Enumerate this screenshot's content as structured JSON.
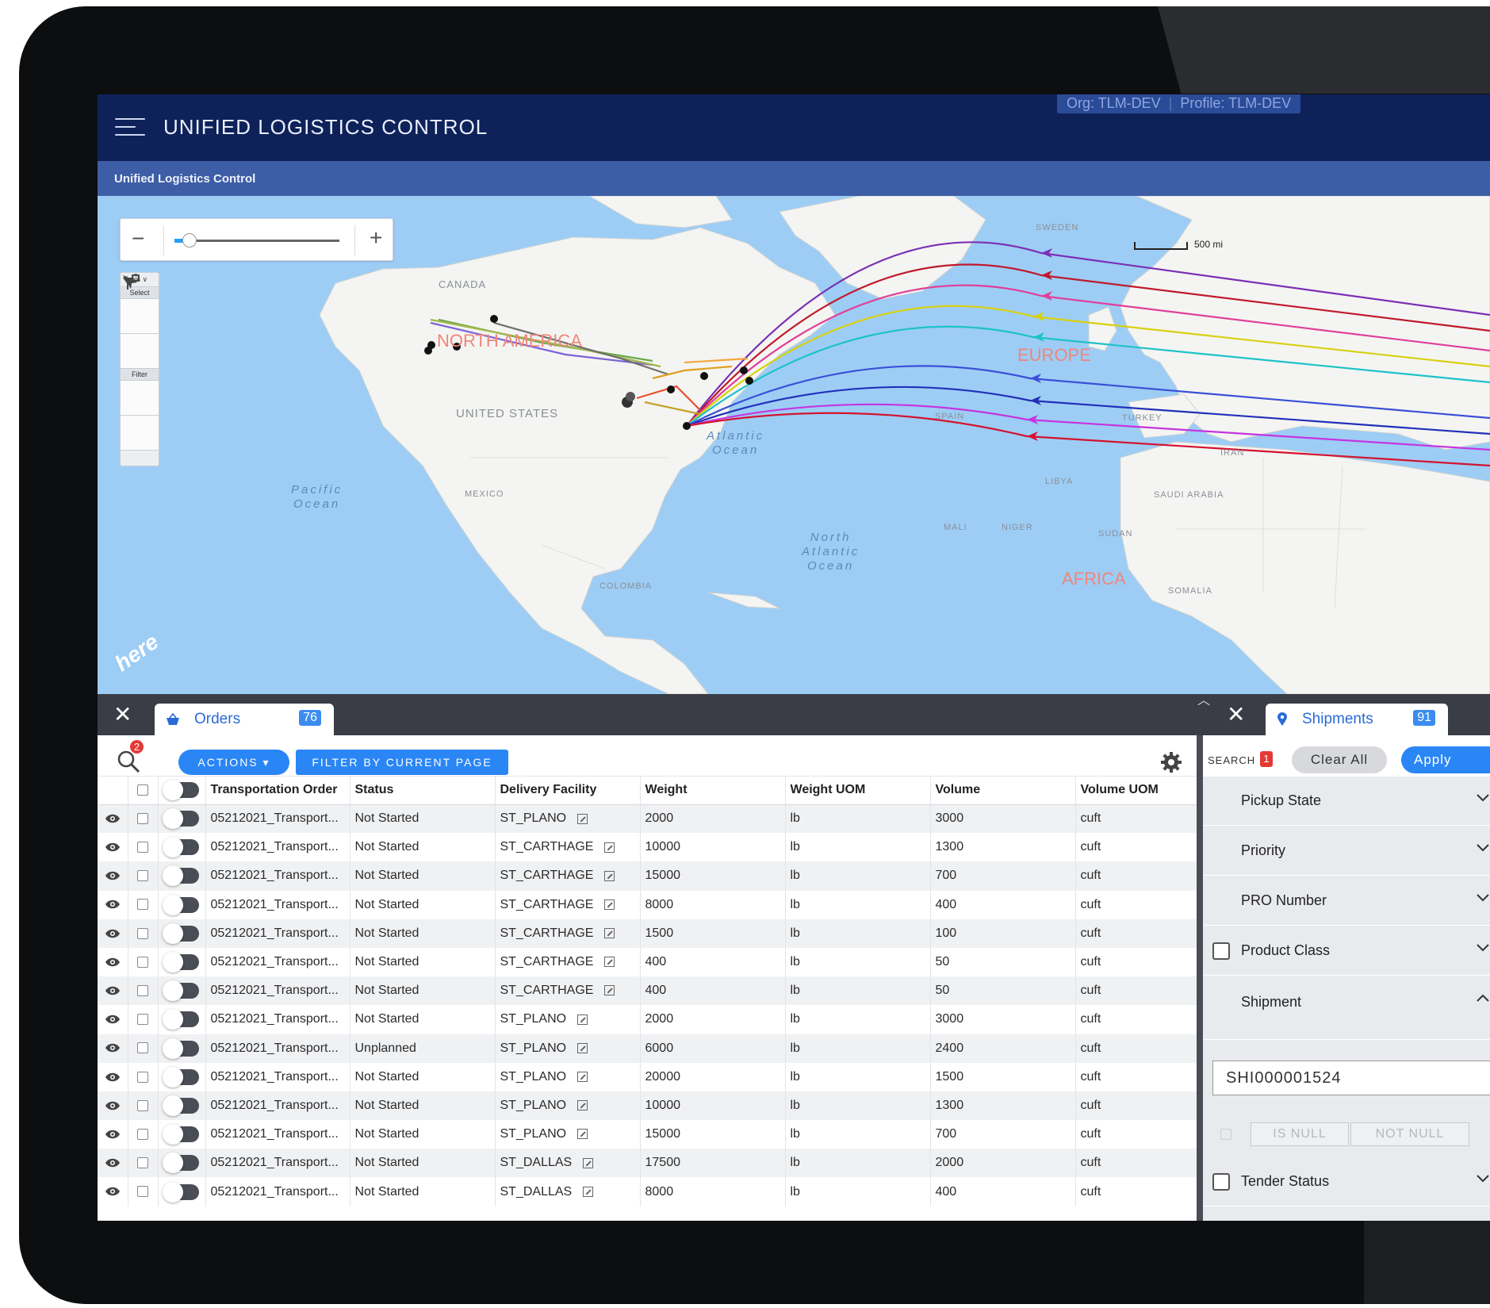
{
  "app": {
    "title": "UNIFIED LOGISTICS CONTROL",
    "org": "Org: TLM-DEV",
    "profile": "Profile: TLM-DEV",
    "breadcrumb": "Unified Logistics Control"
  },
  "map": {
    "zoom_level": 0.09,
    "toolbox": {
      "title": "Tools ∨",
      "select_label": "Select",
      "filter_label": "Filter"
    },
    "scale_label": "500 mi",
    "labels": {
      "canada": "CANADA",
      "north_america": "NORTH AMERICA",
      "united_states": "UNITED STATES",
      "mexico": "MEXICO",
      "colombia": "COLOMBIA",
      "pacific": "Pacific\nOcean",
      "atlantic": "Atlantic\nOcean",
      "north_atlantic": "North\nAtlantic\nOcean",
      "europe": "EUROPE",
      "africa": "AFRICA",
      "sweden": "SWEDEN",
      "spain": "SPAIN",
      "turkey": "TURKEY",
      "iran": "IRAN",
      "libya": "LIBYA",
      "saudi_arabia": "SAUDI ARABIA",
      "mali": "MALI",
      "niger": "NIGER",
      "sudan": "SUDAN",
      "somalia": "SOMALIA"
    },
    "route_colors": [
      "#7b2fb5",
      "#c0192c",
      "#e0409a",
      "#d8d010",
      "#1ec2c9",
      "#3b4fd8",
      "#2230b8",
      "#c534e0",
      "#d4132f",
      "#e1d520"
    ],
    "logo": "here"
  },
  "orders": {
    "tab_label": "Orders",
    "count": "76",
    "search_badge": "2",
    "actions_label": "ACTIONS ▾",
    "filter_label": "FILTER BY CURRENT PAGE",
    "columns": [
      "Transportation Order",
      "Status",
      "Delivery Facility",
      "Weight",
      "Weight UOM",
      "Volume",
      "Volume UOM"
    ],
    "rows": [
      [
        "05212021_Transport...",
        "Not Started",
        "ST_PLANO",
        "2000",
        "lb",
        "3000",
        "cuft"
      ],
      [
        "05212021_Transport...",
        "Not Started",
        "ST_CARTHAGE",
        "10000",
        "lb",
        "1300",
        "cuft"
      ],
      [
        "05212021_Transport...",
        "Not Started",
        "ST_CARTHAGE",
        "15000",
        "lb",
        "700",
        "cuft"
      ],
      [
        "05212021_Transport...",
        "Not Started",
        "ST_CARTHAGE",
        "8000",
        "lb",
        "400",
        "cuft"
      ],
      [
        "05212021_Transport...",
        "Not Started",
        "ST_CARTHAGE",
        "1500",
        "lb",
        "100",
        "cuft"
      ],
      [
        "05212021_Transport...",
        "Not Started",
        "ST_CARTHAGE",
        "400",
        "lb",
        "50",
        "cuft"
      ],
      [
        "05212021_Transport...",
        "Not Started",
        "ST_CARTHAGE",
        "400",
        "lb",
        "50",
        "cuft"
      ],
      [
        "05212021_Transport...",
        "Not Started",
        "ST_PLANO",
        "2000",
        "lb",
        "3000",
        "cuft"
      ],
      [
        "05212021_Transport...",
        "Unplanned",
        "ST_PLANO",
        "6000",
        "lb",
        "2400",
        "cuft"
      ],
      [
        "05212021_Transport...",
        "Not Started",
        "ST_PLANO",
        "20000",
        "lb",
        "1500",
        "cuft"
      ],
      [
        "05212021_Transport...",
        "Not Started",
        "ST_PLANO",
        "10000",
        "lb",
        "1300",
        "cuft"
      ],
      [
        "05212021_Transport...",
        "Not Started",
        "ST_PLANO",
        "15000",
        "lb",
        "700",
        "cuft"
      ],
      [
        "05212021_Transport...",
        "Not Started",
        "ST_DALLAS",
        "17500",
        "lb",
        "2000",
        "cuft"
      ],
      [
        "05212021_Transport...",
        "Not Started",
        "ST_DALLAS",
        "8000",
        "lb",
        "400",
        "cuft"
      ]
    ]
  },
  "shipments": {
    "tab_label": "Shipments",
    "count": "91",
    "search_label": "SEARCH",
    "search_badge": "1",
    "clear_all": "Clear All",
    "apply": "Apply",
    "facets": {
      "pickup_state": "Pickup State",
      "priority": "Priority",
      "pro_number": "PRO Number",
      "product_class": "Product Class",
      "shipment": "Shipment",
      "tender_status": "Tender Status"
    },
    "shipment_value": "SHI000001524",
    "is_null": "IS NULL",
    "not_null": "NOT NULL"
  }
}
